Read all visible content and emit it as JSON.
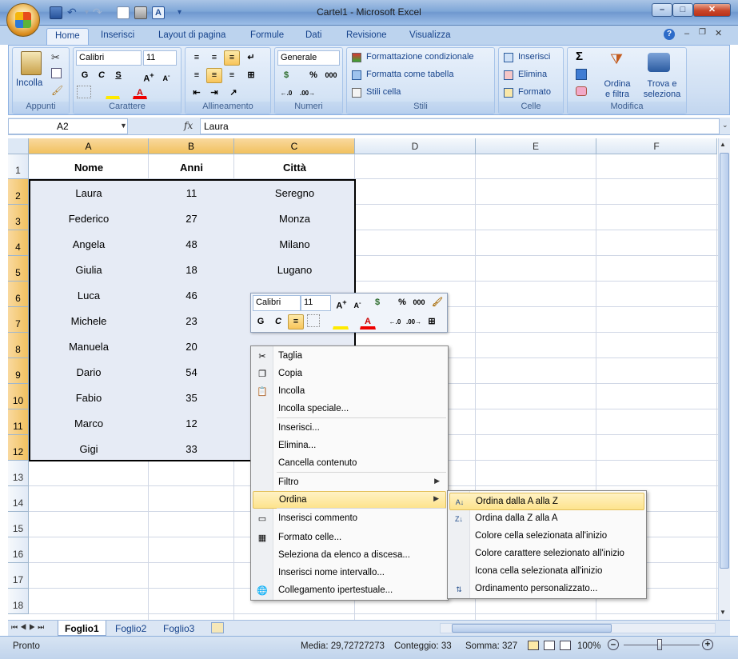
{
  "window": {
    "title": "Cartel1 - Microsoft Excel"
  },
  "tabs": [
    "Home",
    "Inserisci",
    "Layout di pagina",
    "Formule",
    "Dati",
    "Revisione",
    "Visualizza"
  ],
  "ribbon": {
    "clipboard": {
      "label": "Appunti",
      "paste": "Incolla"
    },
    "font": {
      "label": "Carattere",
      "name": "Calibri",
      "size": "11",
      "bold": "G",
      "italic": "C",
      "underline": "S"
    },
    "alignment": {
      "label": "Allineamento"
    },
    "number": {
      "label": "Numeri",
      "format": "Generale",
      "percent": "%",
      "thousands": "000"
    },
    "styles": {
      "label": "Stili",
      "cond": "Formattazione condizionale",
      "table": "Formatta come tabella",
      "cell": "Stili cella"
    },
    "cells": {
      "label": "Celle",
      "insert": "Inserisci",
      "delete": "Elimina",
      "format": "Formato"
    },
    "editing": {
      "label": "Modifica",
      "sigma": "Σ",
      "sort1": "Ordina",
      "sort2": "e filtra",
      "find1": "Trova e",
      "find2": "seleziona"
    }
  },
  "formula_bar": {
    "name_box": "A2",
    "fx": "fx",
    "value": "Laura"
  },
  "grid": {
    "columns": [
      "A",
      "B",
      "C",
      "D",
      "E",
      "F"
    ],
    "rows": [
      "1",
      "2",
      "3",
      "4",
      "5",
      "6",
      "7",
      "8",
      "9",
      "10",
      "11",
      "12",
      "13",
      "14",
      "15",
      "16",
      "17",
      "18"
    ],
    "headers": [
      "Nome",
      "Anni",
      "Città"
    ],
    "data": [
      [
        "Laura",
        "11",
        "Seregno"
      ],
      [
        "Federico",
        "27",
        "Monza"
      ],
      [
        "Angela",
        "48",
        "Milano"
      ],
      [
        "Giulia",
        "18",
        "Lugano"
      ],
      [
        "Luca",
        "46",
        ""
      ],
      [
        "Michele",
        "23",
        ""
      ],
      [
        "Manuela",
        "20",
        ""
      ],
      [
        "Dario",
        "54",
        ""
      ],
      [
        "Fabio",
        "35",
        ""
      ],
      [
        "Marco",
        "12",
        ""
      ],
      [
        "Gigi",
        "33",
        ""
      ]
    ]
  },
  "mini_toolbar": {
    "font": "Calibri",
    "size": "11",
    "bold": "G",
    "italic": "C",
    "percent": "%",
    "thousands": "000"
  },
  "context_menu": [
    {
      "label": "Taglia",
      "icon": "scissors-icon"
    },
    {
      "label": "Copia",
      "icon": "copy-icon"
    },
    {
      "label": "Incolla",
      "icon": "paste-icon"
    },
    {
      "label": "Incolla speciale...",
      "icon": ""
    },
    {
      "label": "Inserisci...",
      "icon": ""
    },
    {
      "label": "Elimina...",
      "icon": ""
    },
    {
      "label": "Cancella contenuto",
      "icon": ""
    },
    {
      "label": "Filtro",
      "icon": ""
    },
    {
      "label": "Ordina",
      "icon": ""
    },
    {
      "label": "Inserisci commento",
      "icon": "comment-icon"
    },
    {
      "label": "Formato celle...",
      "icon": "format-cells-icon"
    },
    {
      "label": "Seleziona da elenco a discesa...",
      "icon": ""
    },
    {
      "label": "Inserisci nome intervallo...",
      "icon": ""
    },
    {
      "label": "Collegamento ipertestuale...",
      "icon": "hyperlink-icon"
    }
  ],
  "sort_submenu": [
    "Ordina dalla A alla Z",
    "Ordina dalla Z alla A",
    "Colore cella selezionata all'inizio",
    "Colore carattere selezionato all'inizio",
    "Icona cella selezionata all'inizio",
    "Ordinamento personalizzato..."
  ],
  "sheets": [
    "Foglio1",
    "Foglio2",
    "Foglio3"
  ],
  "status": {
    "ready": "Pronto",
    "average": "Media: 29,72727273",
    "count": "Conteggio: 33",
    "sum": "Somma: 327",
    "zoom": "100%"
  }
}
